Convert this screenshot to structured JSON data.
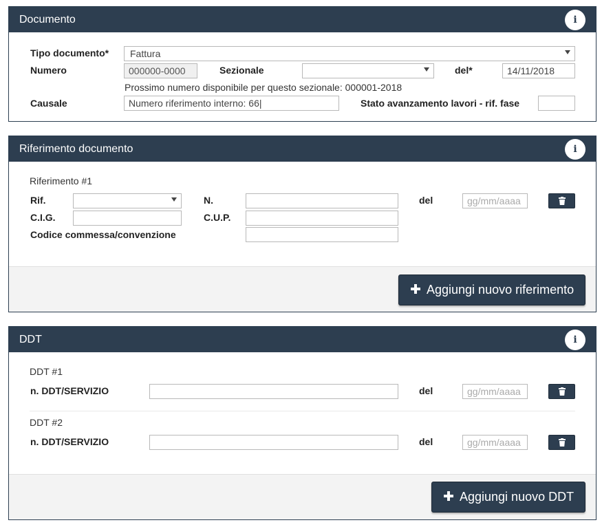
{
  "documento": {
    "title": "Documento",
    "info_icon": "info-icon",
    "tipo_label": "Tipo documento*",
    "tipo_value": "Fattura",
    "numero_label": "Numero",
    "numero_value": "000000-0000",
    "sezionale_label": "Sezionale",
    "sezionale_value": "",
    "del_label": "del*",
    "del_value": "14/11/2018",
    "hint": "Prossimo numero disponibile per questo sezionale: 000001-2018",
    "causale_label": "Causale",
    "causale_value": "Numero riferimento interno: 66|",
    "stato_label": "Stato avanzamento lavori - rif. fase",
    "stato_value": ""
  },
  "riferimento": {
    "title": "Riferimento documento",
    "item_title": "Riferimento #1",
    "rif_label": "Rif.",
    "rif_value": "",
    "n_label": "N.",
    "n_value": "",
    "del_label": "del",
    "del_placeholder": "gg/mm/aaaa",
    "cig_label": "C.I.G.",
    "cig_value": "",
    "cup_label": "C.U.P.",
    "cup_value": "",
    "commessa_label": "Codice commessa/convenzione",
    "commessa_value": "",
    "add_label": "Aggiungi nuovo riferimento"
  },
  "ddt": {
    "title": "DDT",
    "items": [
      {
        "title": "DDT #1",
        "n_label": "n. DDT/SERVIZIO",
        "n_value": "",
        "del_label": "del",
        "del_placeholder": "gg/mm/aaaa"
      },
      {
        "title": "DDT #2",
        "n_label": "n. DDT/SERVIZIO",
        "n_value": "",
        "del_label": "del",
        "del_placeholder": "gg/mm/aaaa"
      }
    ],
    "add_label": "Aggiungi nuovo DDT"
  },
  "colors": {
    "header_bg": "#2d3e50",
    "button_bg": "#2d3e50",
    "footer_bg": "#f3f3f3"
  }
}
